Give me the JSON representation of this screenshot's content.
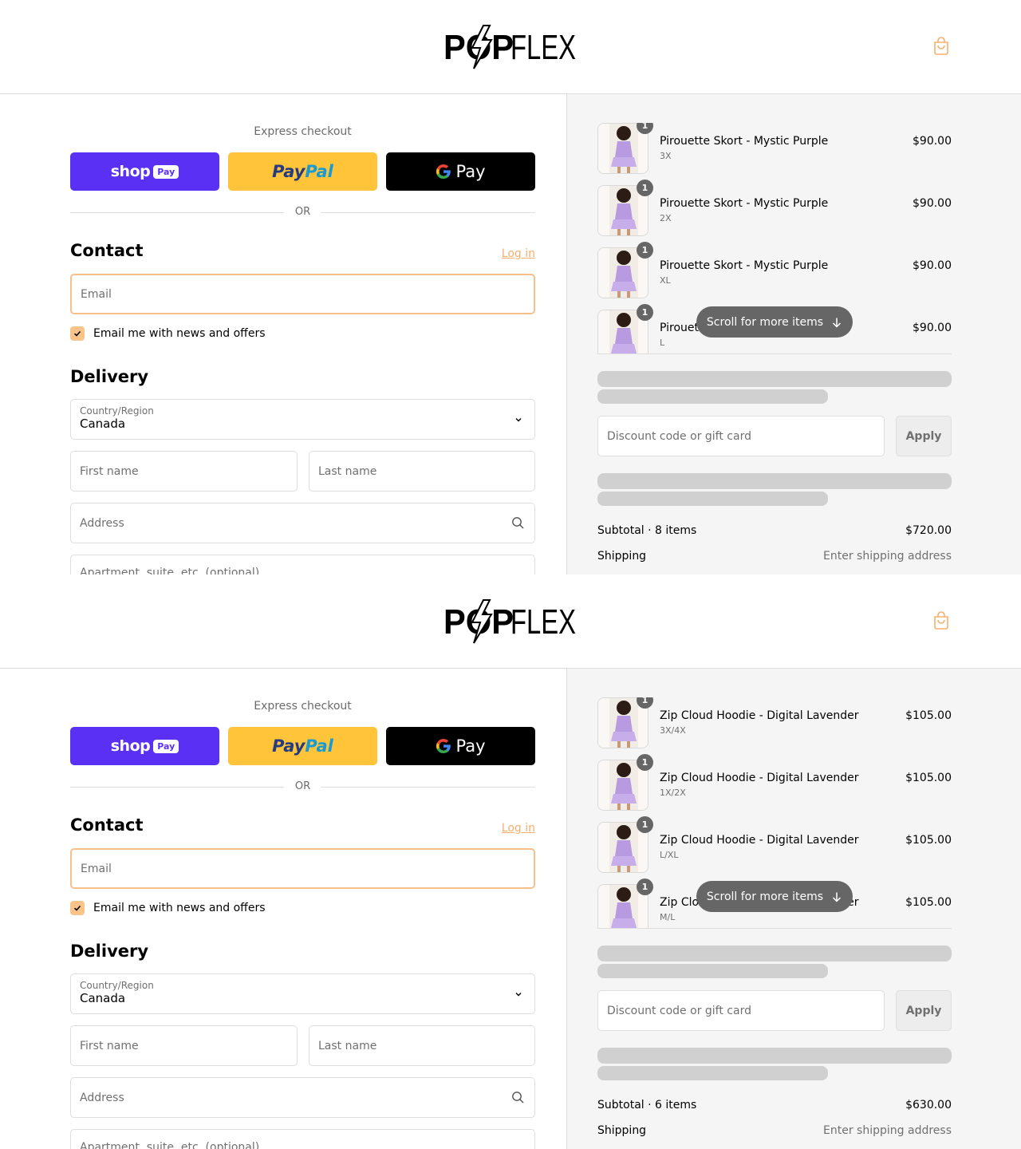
{
  "colors": {
    "shop_pay": "#5a31f4",
    "paypal": "#ffc439",
    "gpay": "#000000",
    "accent": "#f7b06b",
    "summary_bg": "#f5f5f5",
    "badge": "#666666",
    "product": "#b89ae0"
  },
  "screens": [
    {
      "brand": "POPFLEX",
      "cart_icon": "shopping-bag-icon",
      "express_label": "Express checkout",
      "shop_pay_word": "shop",
      "shop_pay_pill": "Pay",
      "paypal_a": "Pay",
      "paypal_b": "Pal",
      "gpay_g": "G",
      "gpay_word": "Pay",
      "or_text": "OR",
      "contact_title": "Contact",
      "login_link": "Log in",
      "email_placeholder": "Email",
      "newsletter_label": "Email me with news and offers",
      "newsletter_checked": true,
      "delivery_title": "Delivery",
      "country_label": "Country/Region",
      "country_value": "Canada",
      "first_name_placeholder": "First name",
      "last_name_placeholder": "Last name",
      "address_placeholder": "Address",
      "apartment_placeholder": "Apartment, suite, etc. (optional)",
      "items": [
        {
          "qty": "1",
          "name": "Pirouette Skort - Mystic Purple",
          "variant": "3X",
          "price": "$90.00"
        },
        {
          "qty": "1",
          "name": "Pirouette Skort - Mystic Purple",
          "variant": "2X",
          "price": "$90.00"
        },
        {
          "qty": "1",
          "name": "Pirouette Skort - Mystic Purple",
          "variant": "XL",
          "price": "$90.00"
        },
        {
          "qty": "1",
          "name": "Pirouette Skort - Mystic Purple",
          "variant": "L",
          "price": "$90.00"
        }
      ],
      "scroll_hint": "Scroll for more items",
      "discount_placeholder": "Discount code or gift card",
      "apply_label": "Apply",
      "subtotal_label": "Subtotal · 8 items",
      "subtotal_value": "$720.00",
      "shipping_label": "Shipping",
      "shipping_value": "Enter shipping address"
    },
    {
      "brand": "POPFLEX",
      "cart_icon": "shopping-bag-icon",
      "express_label": "Express checkout",
      "shop_pay_word": "shop",
      "shop_pay_pill": "Pay",
      "paypal_a": "Pay",
      "paypal_b": "Pal",
      "gpay_g": "G",
      "gpay_word": "Pay",
      "or_text": "OR",
      "contact_title": "Contact",
      "login_link": "Log in",
      "email_placeholder": "Email",
      "newsletter_label": "Email me with news and offers",
      "newsletter_checked": true,
      "delivery_title": "Delivery",
      "country_label": "Country/Region",
      "country_value": "Canada",
      "first_name_placeholder": "First name",
      "last_name_placeholder": "Last name",
      "address_placeholder": "Address",
      "apartment_placeholder": "Apartment, suite, etc. (optional)",
      "items": [
        {
          "qty": "1",
          "name": "Zip Cloud Hoodie - Digital Lavender",
          "variant": "3X/4X",
          "price": "$105.00"
        },
        {
          "qty": "1",
          "name": "Zip Cloud Hoodie - Digital Lavender",
          "variant": "1X/2X",
          "price": "$105.00"
        },
        {
          "qty": "1",
          "name": "Zip Cloud Hoodie - Digital Lavender",
          "variant": "L/XL",
          "price": "$105.00"
        },
        {
          "qty": "1",
          "name": "Zip Cloud Hoodie - Digital Lavender",
          "variant": "M/L",
          "price": "$105.00"
        }
      ],
      "scroll_hint": "Scroll for more items",
      "discount_placeholder": "Discount code or gift card",
      "apply_label": "Apply",
      "subtotal_label": "Subtotal · 6 items",
      "subtotal_value": "$630.00",
      "shipping_label": "Shipping",
      "shipping_value": "Enter shipping address"
    }
  ]
}
